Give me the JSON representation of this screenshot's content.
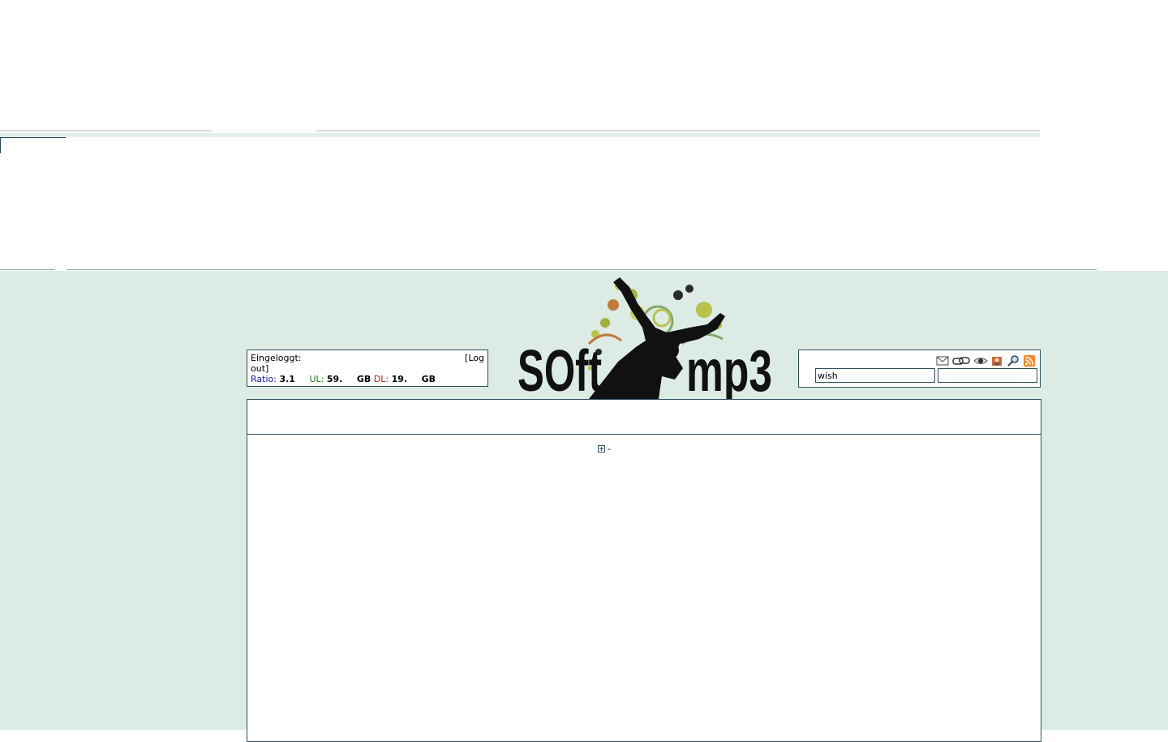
{
  "login": {
    "logged_in_label": "Eingeloggt:",
    "logout_label": "[Log",
    "logout_label_cont": "out]",
    "ratio_label": "Ratio:",
    "ratio_value": "3.1",
    "ul_label": "UL:",
    "ul_value": "59.",
    "ul_unit": "GB",
    "dl_label": "DL:",
    "dl_value": "19.",
    "dl_unit": "GB"
  },
  "logo": {
    "text_left": "SOft",
    "text_right": "mp3"
  },
  "search": {
    "value": "wish",
    "icons": [
      "mail-icon",
      "link-icon",
      "eye-icon",
      "user-icon",
      "search-icon",
      "rss-icon"
    ]
  },
  "content": {
    "expander_label": "-"
  },
  "colors": {
    "page_bg": "#dcebe4",
    "border": "#2f4f5f",
    "rss": "#f0872a"
  }
}
